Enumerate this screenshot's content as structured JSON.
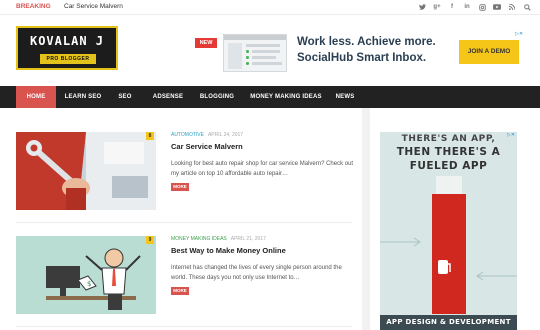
{
  "topbar": {
    "breaking_label": "BREAKING",
    "breaking_text": "Car Service Malvern",
    "socials": [
      "twitter",
      "google-plus",
      "facebook",
      "linkedin",
      "instagram",
      "youtube",
      "rss",
      "search"
    ]
  },
  "logo": {
    "title": "KOVALAN J",
    "subtitle": "PRO BLOGGER"
  },
  "header_ad": {
    "badge": "NEW",
    "line1": "Work less. Achieve more.",
    "line2": "SocialHub Smart Inbox.",
    "button": "JOIN A DEMO",
    "adchoices": "▷✕"
  },
  "nav": {
    "items": [
      "HOME",
      "LEARN SEO",
      "SEO",
      "ADSENSE",
      "BLOGGING",
      "MONEY MAKING IDEAS",
      "NEWS"
    ],
    "active": "HOME"
  },
  "posts": [
    {
      "number": "8",
      "category": "AUTOMOTIVE",
      "date": "APRIL 24, 2017",
      "title": "Car Service Malvern",
      "excerpt": "Looking for best auto repair shop for car service Malvern? Check out my article on top 10 affordable auto repair…",
      "more": "MORE"
    },
    {
      "number": "9",
      "category": "MONEY MAKING IDEAS",
      "date": "APRIL 21, 2017",
      "title": "Best Way to Make Money Online",
      "excerpt": "Internet has changed the lives of every single person around the world. These days you not only use Internet to…",
      "more": "MORE"
    }
  ],
  "sidebar_ad": {
    "line1": "THERE'S AN APP,",
    "line2": "THEN THERE'S A",
    "line3": "FUELED APP",
    "bottom": "APP DESIGN & DEVELOPMENT",
    "adchoices": "▷✕"
  },
  "colors": {
    "accent": "#d9534f",
    "nav_bg": "#222222",
    "logo_yellow": "#e3c21a",
    "ad_button": "#f5c518",
    "category_blue": "#2aa3c7"
  }
}
